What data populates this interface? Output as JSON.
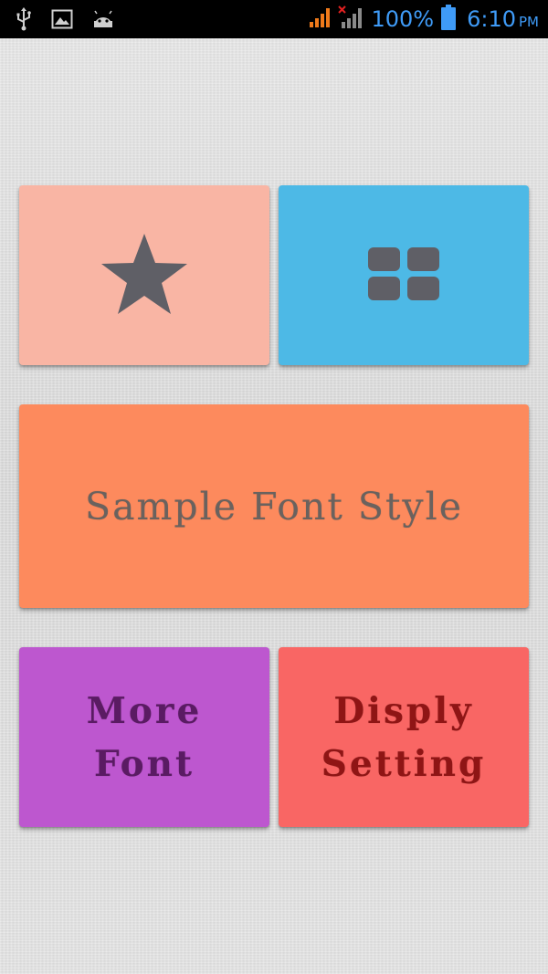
{
  "status_bar": {
    "icons_left": [
      "usb-icon",
      "image-icon",
      "android-icon"
    ],
    "battery_percent": "100%",
    "time": "6:10",
    "ampm": "PM",
    "signal_color": "#f07a1a",
    "text_color": "#3f9bf7"
  },
  "tiles": {
    "favorite": {
      "icon": "star-icon",
      "color": "#f9b5a4",
      "icon_color": "#5f5f66"
    },
    "grid": {
      "icon": "grid-icon",
      "color": "#4db9e6",
      "icon_color": "#5f5f66"
    },
    "sample": {
      "text": "Sample Font Style",
      "color": "#fd8a5d"
    },
    "more_font": {
      "line1": "More",
      "line2": "Font",
      "color": "#bd57cf"
    },
    "display_setting": {
      "line1": "Disply",
      "line2": "Setting",
      "color": "#f96664"
    }
  }
}
